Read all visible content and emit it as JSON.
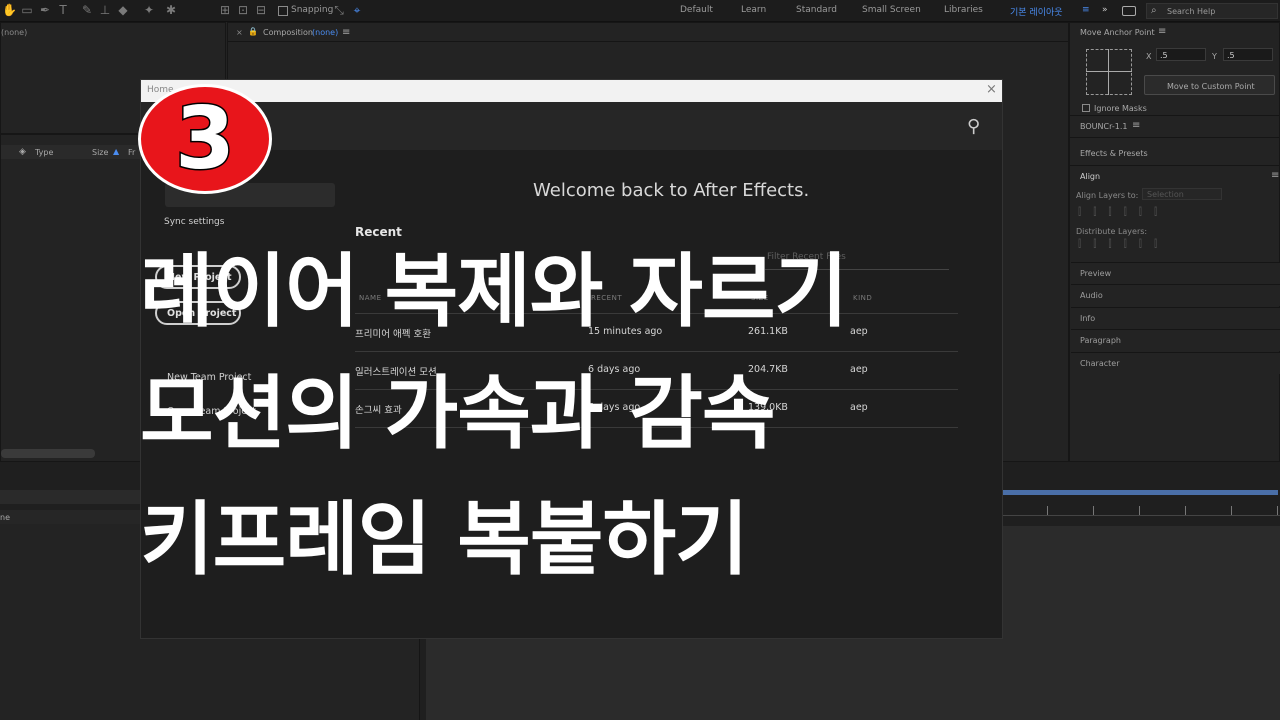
{
  "toolbar": {
    "snapping_label": "Snapping",
    "workspaces": [
      "Default",
      "Learn",
      "Standard",
      "Small Screen",
      "Libraries"
    ],
    "active_workspace": "기본 레이아웃",
    "search_placeholder": "Search Help"
  },
  "project_panel": {
    "none_label": "(none)",
    "col_type": "Type",
    "col_size": "Size",
    "col_frame": "Fr"
  },
  "composition_panel": {
    "title": "Composition",
    "title_suffix": "(none)"
  },
  "timeline": {
    "none_label": "ne"
  },
  "right_panel": {
    "anchor_title": "Move Anchor Point",
    "x_label": "X",
    "x_value": ".5",
    "y_label": "Y",
    "y_value": ".5",
    "custom_button": "Move to Custom Point",
    "ignore_masks": "Ignore Masks",
    "bouncr_title": "BOUNCr-1.1",
    "effects_presets": "Effects & Presets",
    "align_title": "Align",
    "align_layers_to": "Align Layers to:",
    "align_select": "Selection",
    "distribute_layers": "Distribute Layers:",
    "preview": "Preview",
    "audio": "Audio",
    "info": "Info",
    "paragraph": "Paragraph",
    "character": "Character"
  },
  "dialog": {
    "title": "Home",
    "welcome": "Welcome back to After Effects.",
    "sync_settings": "Sync settings",
    "new_project": "New Project",
    "open_project": "Open Project",
    "new_team_project": "New Team Project",
    "open_team_project": "Open Team Project",
    "recent_title": "Recent",
    "filter_placeholder": "Filter Recent Files",
    "columns": {
      "name": "NAME",
      "recent": "RECENT",
      "size": "SIZE",
      "kind": "KIND"
    },
    "recent_files": [
      {
        "name": "프리미어 애펙 호환",
        "recent": "15 minutes ago",
        "size": "261.1KB",
        "kind": "aep"
      },
      {
        "name": "일러스트레이션 모션",
        "recent": "6 days ago",
        "size": "204.7KB",
        "kind": "aep"
      },
      {
        "name": "손그씨 효과",
        "recent": "6 days ago",
        "size": "139.0KB",
        "kind": "aep"
      }
    ]
  },
  "overlay": {
    "badge_number": "3",
    "line1": "레이어 복제와 자르기",
    "line2": "모션의 가속과 감속",
    "line3": "키프레임 복붙하기"
  },
  "colors": {
    "badge_red": "#e8151b",
    "accent_blue": "#4a8cf0",
    "overlay_text": "#ffffff"
  }
}
